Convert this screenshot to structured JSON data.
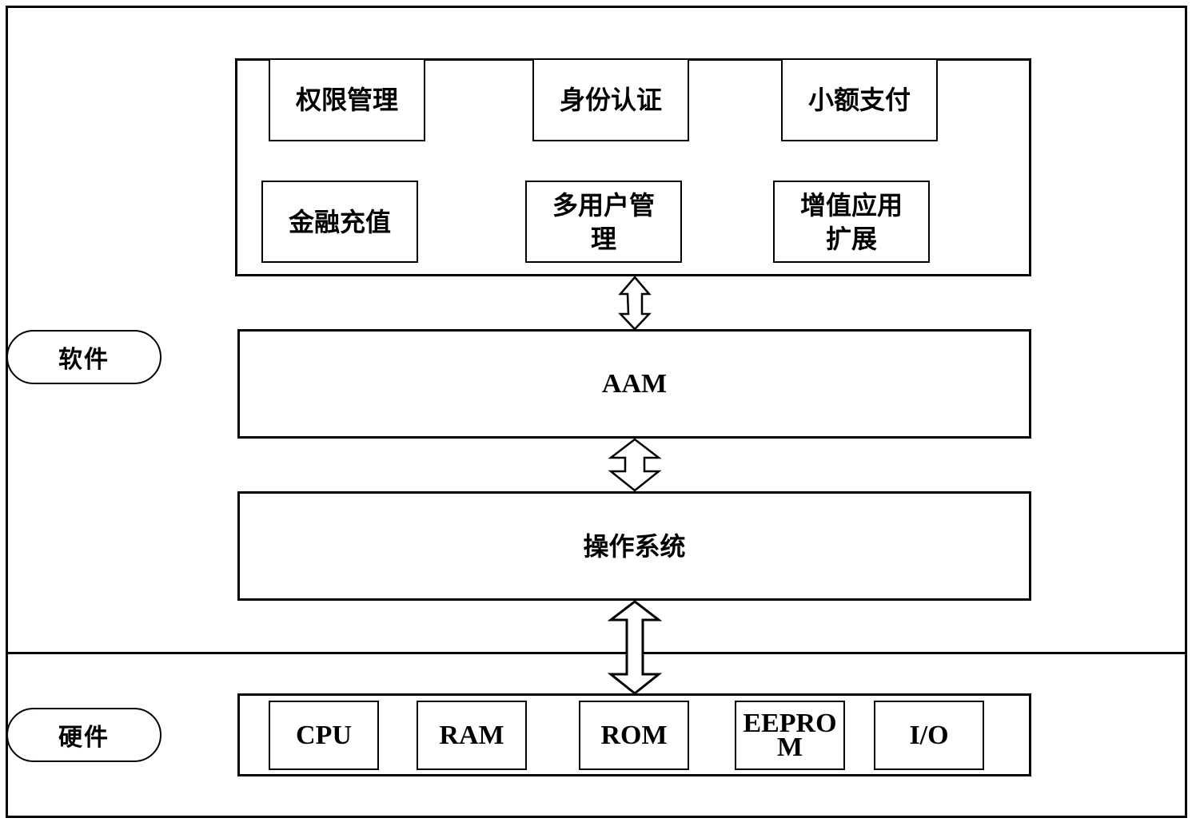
{
  "sections": {
    "software_label": "软件",
    "hardware_label": "硬件"
  },
  "applications": [
    {
      "label": "权限管理"
    },
    {
      "label": "身份认证"
    },
    {
      "label": "小额支付"
    },
    {
      "label": "金融充值"
    },
    {
      "label": "多用户管\n理"
    },
    {
      "label": "增值应用\n扩展"
    }
  ],
  "layers": {
    "aam": "AAM",
    "os": "操作系统"
  },
  "hardware": [
    {
      "label": "CPU"
    },
    {
      "label": "RAM"
    },
    {
      "label": "ROM"
    },
    {
      "label": "EEPRO\nM"
    },
    {
      "label": "I/O"
    }
  ],
  "connectors": [
    {
      "from": "applications",
      "to": "aam",
      "type": "bidirectional"
    },
    {
      "from": "aam",
      "to": "os",
      "type": "bidirectional"
    },
    {
      "from": "os",
      "to": "hardware",
      "type": "bidirectional"
    }
  ]
}
